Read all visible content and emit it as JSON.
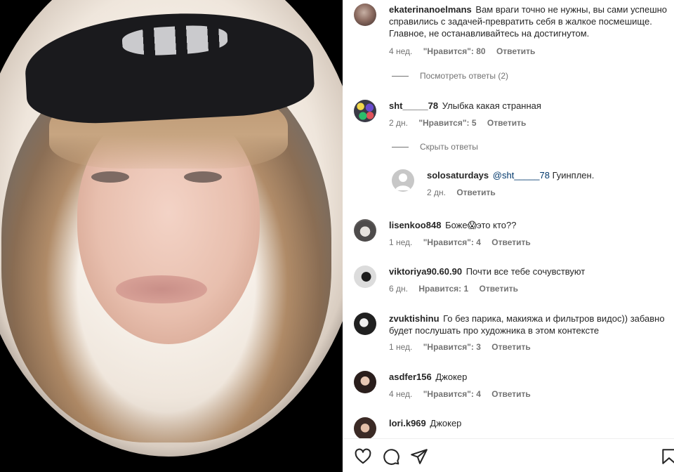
{
  "comments": [
    {
      "username": "ekaterinanoelmans",
      "text": "Вам враги точно не нужны, вы сами успешно справились с задачей-превратить себя в жалкое посмешище. Главное, не останавливайтесь на достигнутом.",
      "time": "4 нед.",
      "likes": "\"Нравится\": 80",
      "reply": "Ответить",
      "toggle": "Посмотреть ответы (2)"
    },
    {
      "username": "sht_____78",
      "text": "Улыбка какая странная",
      "time": "2 дн.",
      "likes": "\"Нравится\": 5",
      "reply": "Ответить",
      "toggle": "Скрыть ответы"
    },
    {
      "username": "lisenkoo848",
      "text": "Боже😱это кто??",
      "time": "1 нед.",
      "likes": "\"Нравится\": 4",
      "reply": "Ответить"
    },
    {
      "username": "viktoriya90.60.90",
      "text": "Почти все тебе сочувствуют",
      "time": "6 дн.",
      "likes": "Нравится: 1",
      "reply": "Ответить"
    },
    {
      "username": "zvuktishinu",
      "text": "Го без парика, макияжа и фильтров видос)) забавно будет послушать про художника в этом контексте",
      "time": "1 нед.",
      "likes": "\"Нравится\": 3",
      "reply": "Ответить"
    },
    {
      "username": "asdfer156",
      "text": "Джокер",
      "time": "4 нед.",
      "likes": "\"Нравится\": 4",
      "reply": "Ответить"
    },
    {
      "username": "lori.k969",
      "text": "Джокер"
    }
  ],
  "reply": {
    "username": "solosaturdays",
    "mention": "@sht_____78",
    "text": "Гуинплен.",
    "time": "2 дн.",
    "reply": "Ответить"
  },
  "actions": {
    "icons": [
      "heart-icon",
      "comment-icon",
      "share-icon",
      "bookmark-icon"
    ]
  }
}
